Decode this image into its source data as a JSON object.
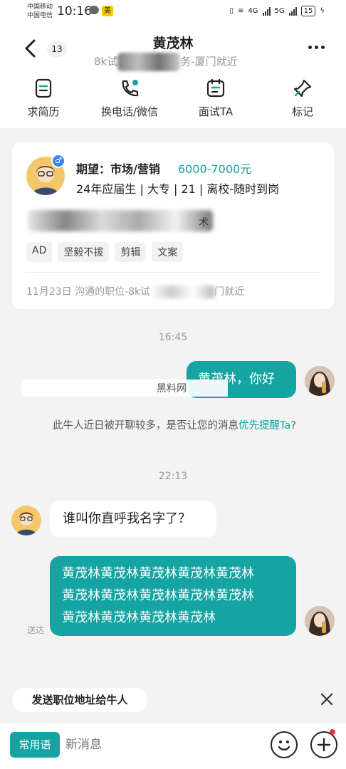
{
  "status_bar": {
    "carrier1": "中国移动",
    "carrier2": "中国电信",
    "time": "10:16",
    "app_badge": "美",
    "net1": "4G",
    "net2": "5G",
    "battery": "15"
  },
  "header": {
    "back_count": "13",
    "title": "黄茂林",
    "subtitle_start": "8k试",
    "subtitle_end": "务-厦门就近"
  },
  "actions": [
    {
      "label": "求简历",
      "icon": "resume-icon"
    },
    {
      "label": "换电话/微信",
      "icon": "phone-icon"
    },
    {
      "label": "面试TA",
      "icon": "calendar-icon"
    },
    {
      "label": "标记",
      "icon": "pin-icon"
    }
  ],
  "card": {
    "expect_label": "期望：市场/营销",
    "salary": "6000-7000元",
    "profile_line": "24年应届生 | 大专 | 21 | 离校-随时到岗",
    "skill_end": "术",
    "tags": [
      "AD",
      "坚毅不拔",
      "剪辑",
      "文案"
    ],
    "footer_start": "11月23日 沟通的职位-8k试",
    "footer_end": "门就近"
  },
  "chat": {
    "time1": "16:45",
    "msg1": "黄茂林，你好",
    "watermark": "黑料网",
    "notice_text": "此牛人近日被开聊较多，是否让您的消息",
    "notice_link": "优先提醒Ta",
    "notice_end": "?",
    "time2": "22:13",
    "msg2": "谁叫你直呼我名字了？",
    "msg3_line1": "黄茂林黄茂林黄茂林黄茂林黄茂林",
    "msg3_line2": "黄茂林黄茂林黄茂林黄茂林黄茂林",
    "msg3_line3": "黄茂林黄茂林黄茂林黄茂林",
    "sent_status": "送达"
  },
  "bottom": {
    "address_chip": "发送职位地址给牛人",
    "common_phrases": "常用语",
    "input_placeholder": "新消息"
  },
  "colors": {
    "accent": "#15a4a2",
    "salary": "#12a3a0"
  }
}
